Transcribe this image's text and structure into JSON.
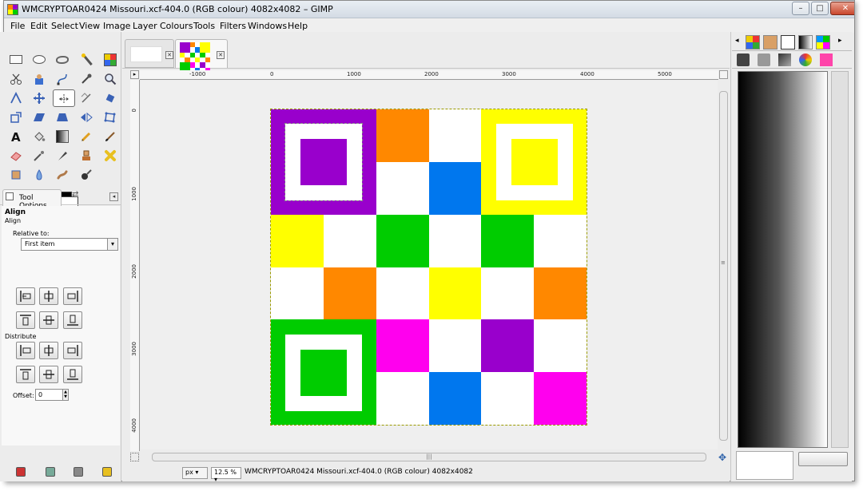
{
  "window": {
    "title": "WMCRYPTOAR0424 Missouri.xcf-404.0 (RGB colour) 4082x4082 – GIMP",
    "minimize": "–",
    "maximize": "□",
    "close": "✕"
  },
  "menubar": {
    "items": [
      {
        "label": "File"
      },
      {
        "label": "Edit"
      },
      {
        "label": "Select"
      },
      {
        "label": "View"
      },
      {
        "label": "Image"
      },
      {
        "label": "Layer"
      },
      {
        "label": "Colours"
      },
      {
        "label": "Tools"
      },
      {
        "label": "Filters"
      },
      {
        "label": "Windows"
      },
      {
        "label": "Help"
      }
    ]
  },
  "tool_options": {
    "tab_label": "Tool Options",
    "title": "Align",
    "subtitle": "Align",
    "relative_label": "Relative to:",
    "relative_value": "First item",
    "distribute_label": "Distribute",
    "offset_label": "Offset:",
    "offset_value": "0"
  },
  "rulers": {
    "h_labels": [
      "-1000",
      "0",
      "1000",
      "2000",
      "3000",
      "4000",
      "5000"
    ],
    "v_labels": [
      "0",
      "1000",
      "2000",
      "3000",
      "4000"
    ]
  },
  "status": {
    "unit": "px",
    "zoom": "12.5 %",
    "text": "WMCRYPTOAR0424 Missouri.xcf-404.0 (RGB colour) 4082x4082"
  },
  "colors": {
    "purple": "#9900cc",
    "orange": "#ff8800",
    "yellow": "#ffff00",
    "blue": "#0077ee",
    "green": "#00cc00",
    "magenta": "#ff00ee",
    "white": "#ffffff"
  },
  "grid": [
    [
      "purple",
      "purple",
      "orange",
      "white",
      "yellow",
      "yellow"
    ],
    [
      "purple",
      "purple",
      "white",
      "blue",
      "yellow",
      "yellow"
    ],
    [
      "yellow",
      "white",
      "green",
      "white",
      "green",
      "white"
    ],
    [
      "white",
      "orange",
      "white",
      "yellow",
      "white",
      "orange"
    ],
    [
      "green",
      "green",
      "magenta",
      "white",
      "purple",
      "white"
    ],
    [
      "green",
      "green",
      "white",
      "blue",
      "white",
      "magenta"
    ]
  ],
  "finder_patterns": [
    "purple",
    "yellow",
    "green"
  ]
}
